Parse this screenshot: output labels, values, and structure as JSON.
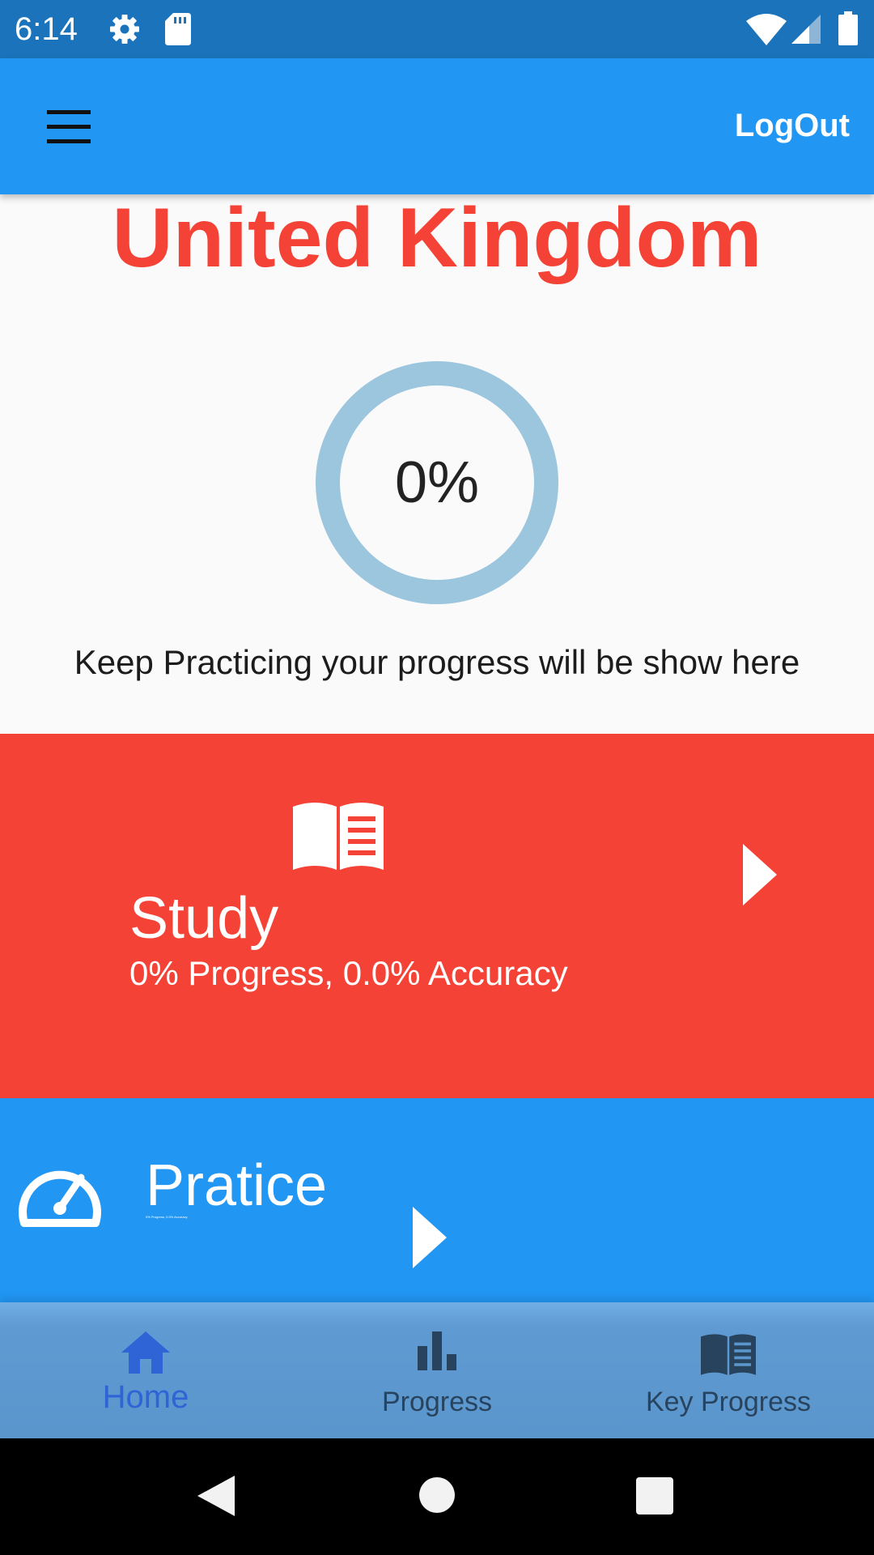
{
  "status_bar": {
    "time": "6:14",
    "icons": [
      "gear-icon",
      "sd-card-icon",
      "wifi-icon",
      "signal-icon",
      "battery-icon"
    ]
  },
  "app_bar": {
    "menu_icon": "hamburger-menu-icon",
    "logout_label": "LogOut"
  },
  "main": {
    "country": "United Kingdom",
    "progress_value": "0%",
    "progress_fraction": 0,
    "progress_hint": "Keep Practicing your progress will be show here"
  },
  "study_card": {
    "icon": "open-book-icon",
    "title": "Study",
    "subtitle": "0% Progress, 0.0% Accuracy",
    "arrow_icon": "play-arrow-icon"
  },
  "practice_card": {
    "icon": "speedometer-icon",
    "title": "Pratice",
    "subtitle": "0% Progress, 0.0% Accuracy",
    "arrow_icon": "play-arrow-icon"
  },
  "bottom_nav": {
    "items": [
      {
        "label": "Home",
        "icon": "home-icon",
        "active": true
      },
      {
        "label": "Progress",
        "icon": "bar-chart-icon",
        "active": false
      },
      {
        "label": "Key Progress",
        "icon": "book-icon",
        "active": false
      }
    ]
  },
  "system_nav": {
    "buttons": [
      "back-icon",
      "home-circle-icon",
      "recents-icon"
    ]
  },
  "colors": {
    "status_bar": "#1b74bb",
    "primary": "#2196f3",
    "accent_red": "#f44336",
    "ring": "#9bc6dd",
    "nav_active": "#2f64d6",
    "nav_inactive": "#28435e"
  }
}
